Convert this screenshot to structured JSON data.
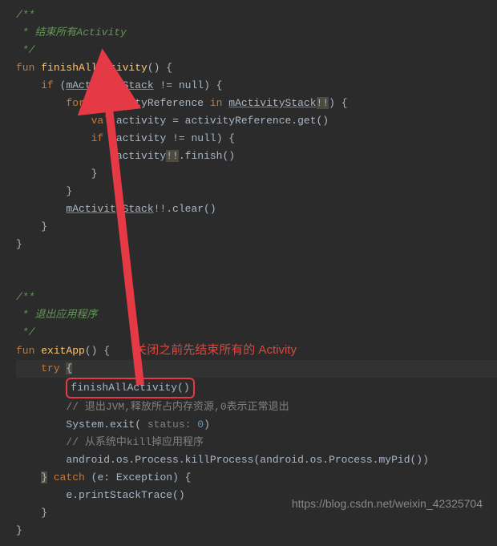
{
  "code": {
    "comment1_open": "/**",
    "comment1_body": " * 结束所有Activity",
    "comment1_close": " */",
    "fun": "fun",
    "fn1": "finishAllActivity",
    "parens": "()",
    "lbrace": " {",
    "if": "if",
    "mStack": "mActivityStack",
    "neqnull": " != null",
    "rparen_brace": ") {",
    "for": "for",
    "in": "in",
    "activityRef": "activityReference",
    "bangbang": "!!",
    "val": "val",
    "activity": "activity",
    "eq": " = ",
    "get": ".get()",
    "finish": ".finish()",
    "clear": "!!.clear()",
    "rbrace": "}",
    "comment2_open": "/**",
    "comment2_body": " * 退出应用程序",
    "comment2_close": " */",
    "fn2": "exitApp",
    "try": "try",
    "callFinish": "finishAllActivity()",
    "cmt_exit": "// 退出JVM,释放所占内存资源,0表示正常退出",
    "sysexit": "System.exit(",
    "status_param": " status: ",
    "zero": "0",
    "rparen": ")",
    "cmt_kill": "// 从系统中kill掉应用程序",
    "killproc": "android.os.Process.killProcess(android.os.Process.myPid())",
    "catch": "catch",
    "exc": " (e: Exception) {",
    "stacktrace": "e.printStackTrace()"
  },
  "annotation": "关闭之前先结束所有的 Activity",
  "watermark": "https://blog.csdn.net/weixin_42325704"
}
